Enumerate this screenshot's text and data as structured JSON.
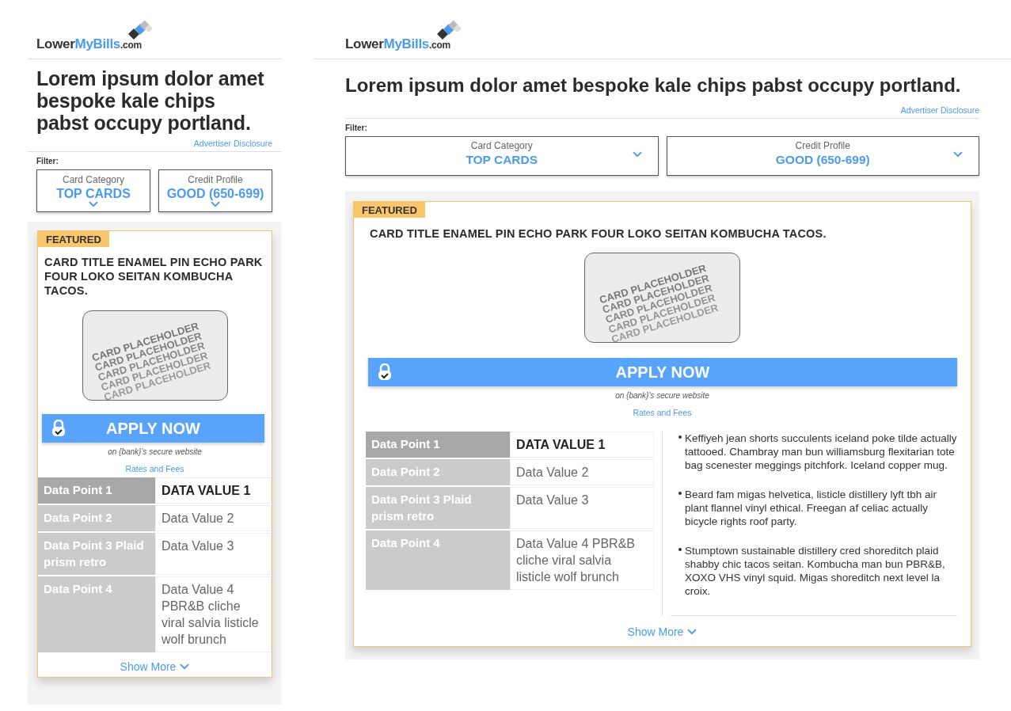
{
  "layouts": [
    {
      "kind": "mobile",
      "logo": {
        "first": "Lower",
        "second": "MyBills",
        "suffix": ".com"
      },
      "heading": "Lorem ipsum dolor amet bespoke kale chips pabst occupy portland.",
      "disclosure": "Advertiser Disclosure",
      "filter_label": "Filter:",
      "filters": [
        {
          "label": "Card Category",
          "value": "TOP CARDS"
        },
        {
          "label": "Credit Profile",
          "value": "GOOD (650-699)"
        }
      ],
      "card": {
        "badge": "FEATURED",
        "title": "CARD TITLE ENAMEL PIN ECHO PARK FOUR LOKO SEITAN KOMBUCHA TACOS.",
        "placeholder_lines": [
          "CARD PLACEHOLDER",
          "CARD PLACEHOLDER",
          "CARD PLACEHOLDER",
          "CARD PLACEHOLDER",
          "CARD PLACEHOLDER"
        ],
        "apply": "APPLY NOW",
        "secure_note": "on {bank}'s secure website",
        "rates_link": "Rates and Fees",
        "rows": [
          {
            "label": "Data Point 1",
            "value": "DATA VALUE 1",
            "emphasized": true
          },
          {
            "label": "Data Point 2",
            "value": "Data Value 2",
            "emphasized": false
          },
          {
            "label": "Data Point 3 Plaid prism retro",
            "value": "Data Value 3",
            "emphasized": false
          },
          {
            "label": "Data Point 4",
            "value": "Data Value 4 PBR&B cliche viral salvia listicle wolf brunch",
            "emphasized": false
          }
        ],
        "show_more": "Show More"
      }
    },
    {
      "kind": "desktop",
      "logo": {
        "first": "Lower",
        "second": "MyBills",
        "suffix": ".com"
      },
      "heading": "Lorem ipsum dolor amet bespoke kale chips pabst occupy portland.",
      "disclosure": "Advertiser Disclosure",
      "filter_label": "Filter:",
      "filters": [
        {
          "label": "Card Category",
          "value": "TOP CARDS"
        },
        {
          "label": "Credit Profile",
          "value": "GOOD (650-699)"
        }
      ],
      "card": {
        "badge": "FEATURED",
        "title": "CARD TITLE ENAMEL PIN ECHO PARK FOUR LOKO SEITAN KOMBUCHA TACOS.",
        "placeholder_lines": [
          "CARD PLACEHOLDER",
          "CARD PLACEHOLDER",
          "CARD PLACEHOLDER",
          "CARD PLACEHOLDER",
          "CARD PLACEHOLDER"
        ],
        "apply": "APPLY NOW",
        "secure_note": "on {bank}'s secure website",
        "rates_link": "Rates and Fees",
        "rows": [
          {
            "label": "Data Point 1",
            "value": "DATA VALUE 1",
            "emphasized": true
          },
          {
            "label": "Data Point 2",
            "value": "Data Value 2",
            "emphasized": false
          },
          {
            "label": "Data Point 3 Plaid prism retro",
            "value": "Data Value 3",
            "emphasized": false
          },
          {
            "label": "Data Point 4",
            "value": "Data Value 4 PBR&B cliche viral salvia listicle wolf brunch",
            "emphasized": false
          }
        ],
        "bullets": [
          "Keffiyeh jean shorts succulents iceland poke tilde actually tattooed. Chambray man bun williamsburg flexitarian tote bag scenester meggings pitchfork. Iceland copper mug.",
          "Beard fam migas helvetica, listicle distillery lyft tbh air plant flannel vinyl ethical. Freegan af celiac actually bicycle rights roof party.",
          "Stumptown sustainable distillery cred  shoreditch plaid shabby chic tacos seitan. Kombucha man bun PBR&B, XOXO VHS vinyl squid. Migas shoreditch next level la croix."
        ],
        "show_more": "Show More"
      }
    }
  ]
}
